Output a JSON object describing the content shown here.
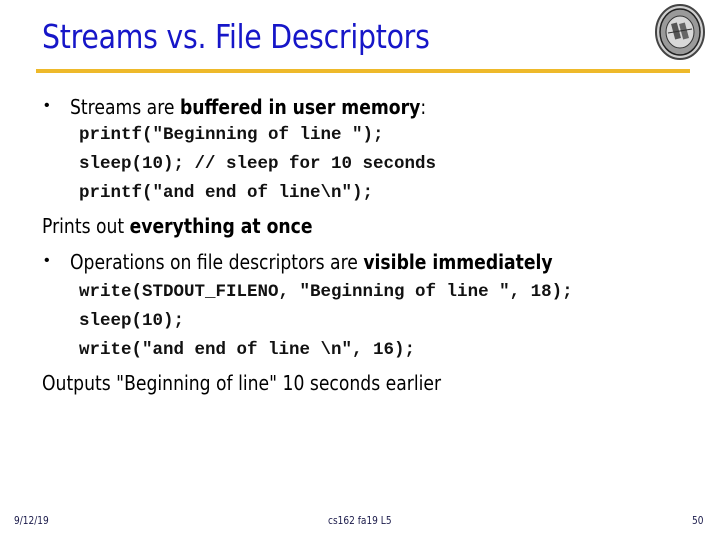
{
  "slide": {
    "title": "Streams vs. File Descriptors",
    "logo_icon": "university-seal-icon",
    "accent_color": "#eeb92a",
    "title_color": "#1616c8"
  },
  "content": {
    "bullet1": {
      "prefix": "Streams are ",
      "bold": "buffered in user memory",
      "suffix": ":"
    },
    "code1": [
      "printf(\"Beginning of line \");",
      "sleep(10); // sleep for 10 seconds",
      "printf(\"and end of line\\n\");"
    ],
    "line1": {
      "prefix": "Prints out ",
      "bold": "everything at once"
    },
    "bullet2": {
      "prefix": "Operations on file descriptors are ",
      "bold": "visible immediately"
    },
    "code2": [
      "write(STDOUT_FILENO, \"Beginning of line \", 18);",
      "sleep(10);",
      "write(\"and end of line \\n\", 16);"
    ],
    "line2": "Outputs \"Beginning of line\" 10 seconds earlier"
  },
  "footer": {
    "date": "9/12/19",
    "course": "cs162 fa19 L5",
    "page": "50"
  }
}
